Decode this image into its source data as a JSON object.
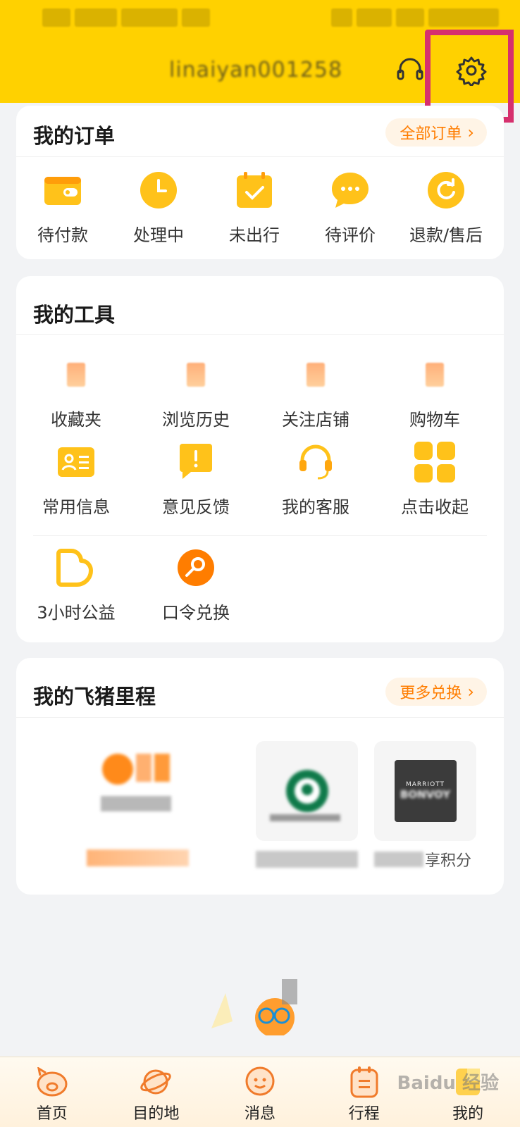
{
  "header": {
    "username": "linaiyan001258",
    "support_icon": "headset-icon",
    "settings_icon": "gear-icon"
  },
  "orders": {
    "title": "我的订单",
    "all_label": "全部订单",
    "items": [
      {
        "label": "待付款",
        "icon": "wallet-icon"
      },
      {
        "label": "处理中",
        "icon": "clock-icon"
      },
      {
        "label": "未出行",
        "icon": "calendar-check-icon"
      },
      {
        "label": "待评价",
        "icon": "chat-bubble-icon"
      },
      {
        "label": "退款/售后",
        "icon": "refresh-icon"
      }
    ]
  },
  "tools": {
    "title": "我的工具",
    "items": [
      {
        "label": "收藏夹",
        "icon": "favorites-icon"
      },
      {
        "label": "浏览历史",
        "icon": "history-icon"
      },
      {
        "label": "关注店铺",
        "icon": "store-icon"
      },
      {
        "label": "购物车",
        "icon": "cart-icon"
      },
      {
        "label": "常用信息",
        "icon": "id-card-icon"
      },
      {
        "label": "意见反馈",
        "icon": "feedback-icon"
      },
      {
        "label": "我的客服",
        "icon": "headset-icon"
      },
      {
        "label": "点击收起",
        "icon": "grid-icon"
      },
      {
        "label": "3小时公益",
        "icon": "charity-heart-icon"
      },
      {
        "label": "口令兑换",
        "icon": "key-icon"
      }
    ]
  },
  "mileage": {
    "title": "我的飞猪里程",
    "more_label": "更多兑换",
    "marriott_text": "MARRIOTT",
    "marriott_sub": "BONVOY",
    "marriott_caption": "享积分"
  },
  "nav": {
    "items": [
      {
        "label": "首页",
        "icon": "pig-home-icon"
      },
      {
        "label": "目的地",
        "icon": "planet-icon"
      },
      {
        "label": "消息",
        "icon": "message-face-icon"
      },
      {
        "label": "行程",
        "icon": "itinerary-icon"
      },
      {
        "label": "我的",
        "icon": "profile-icon"
      }
    ]
  },
  "watermark": "Baidu 经验",
  "colors": {
    "header_bg": "#ffd100",
    "accent": "#ff7d00",
    "icon_yellow": "#ffc21a",
    "highlight": "#d6306e"
  }
}
